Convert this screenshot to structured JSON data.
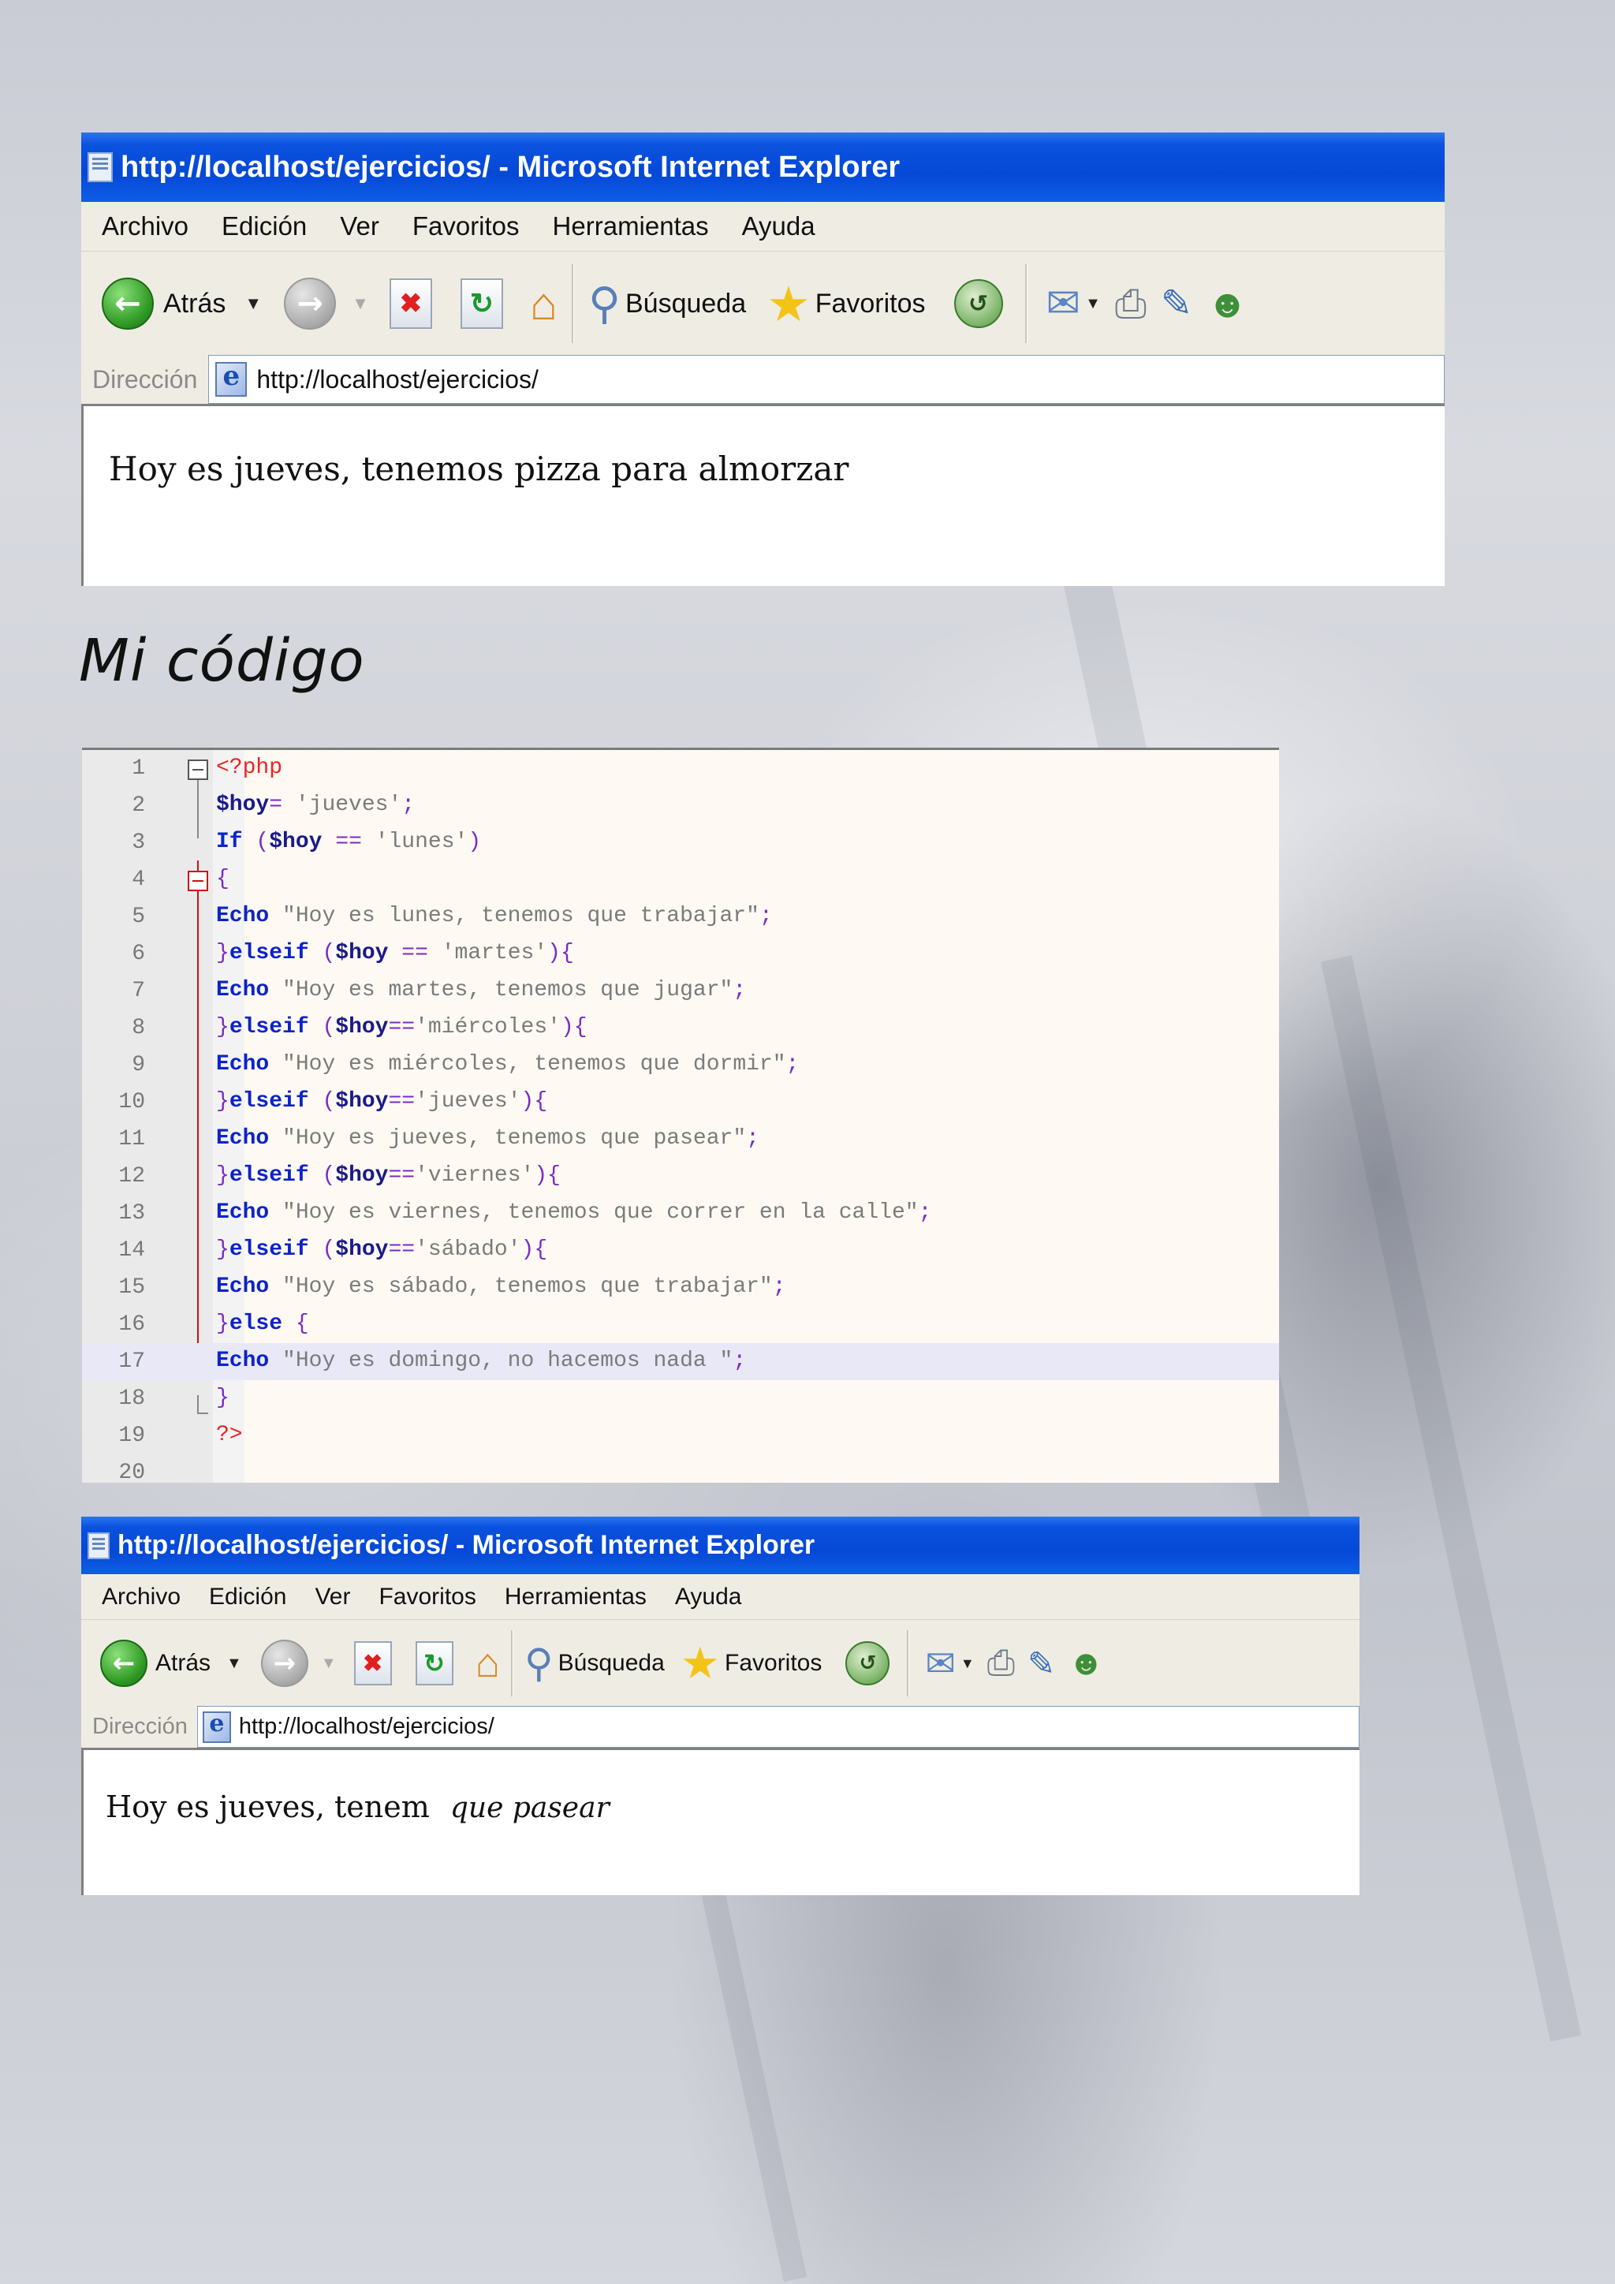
{
  "browser": {
    "title": "http://localhost/ejercicios/ - Microsoft Internet Explorer",
    "menu": [
      "Archivo",
      "Edición",
      "Ver",
      "Favoritos",
      "Herramientas",
      "Ayuda"
    ],
    "toolbar": {
      "back_label": "Atrás",
      "search_label": "Búsqueda",
      "favorites_label": "Favoritos"
    },
    "address_label": "Dirección",
    "url": "http://localhost/ejercicios/"
  },
  "window1": {
    "content": "Hoy es jueves, tenemos pizza para almorzar"
  },
  "heading": "Mi código",
  "code": {
    "line_numbers": [
      "1",
      "2",
      "3",
      "4",
      "5",
      "6",
      "7",
      "8",
      "9",
      "10",
      "11",
      "12",
      "13",
      "14",
      "15",
      "16",
      "17",
      "18",
      "19",
      "20"
    ],
    "lines": [
      "<?php",
      "$hoy= 'jueves';",
      "If ($hoy == 'lunes')",
      "{",
      "Echo \"Hoy es lunes, tenemos que trabajar\";",
      "}elseif ($hoy == 'martes'){",
      "Echo \"Hoy es martes, tenemos que jugar\";",
      "}elseif ($hoy=='miércoles'){",
      "Echo \"Hoy es miércoles, tenemos que dormir\";",
      "}elseif ($hoy=='jueves'){",
      "Echo \"Hoy es jueves, tenemos que pasear\";",
      "}elseif ($hoy=='viernes'){",
      "Echo \"Hoy es viernes, tenemos que correr en la calle\";",
      "}elseif ($hoy=='sábado'){",
      "Echo \"Hoy es sábado, tenemos que trabajar\";",
      "}else {",
      "Echo \"Hoy es domingo, no hacemos nada \";",
      "}",
      "?>",
      ""
    ]
  },
  "window2": {
    "content_part1": "Hoy es jueves, tenem",
    "content_part2": "que pasear"
  },
  "colors": {
    "title_bar": "#0548d6",
    "keyword": "#0b23c9",
    "php_tag": "#e22222",
    "operator": "#7a2bc4",
    "fold_marker": "#d01010",
    "highlight_row": "#e9e8f7"
  }
}
